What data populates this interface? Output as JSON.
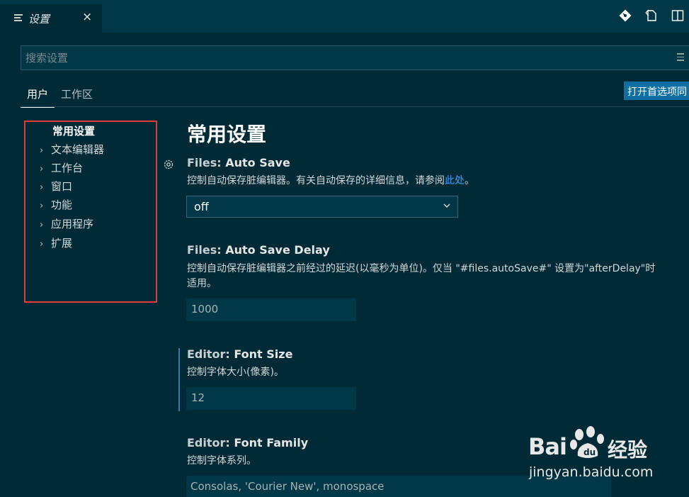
{
  "tab": {
    "label": "设置",
    "close": "×"
  },
  "top_icons": [
    "open-changes-icon",
    "open-file-icon",
    "split-editor-icon"
  ],
  "search": {
    "placeholder": "搜索设置",
    "value": ""
  },
  "scope_tabs": [
    {
      "label": "用户",
      "active": true
    },
    {
      "label": "工作区",
      "active": false
    }
  ],
  "open_json_label": "打开首选项同",
  "toc": {
    "header": "常用设置",
    "items": [
      "文本编辑器",
      "工作台",
      "窗口",
      "功能",
      "应用程序",
      "扩展"
    ]
  },
  "main": {
    "title": "常用设置",
    "settings": [
      {
        "category": "Files: ",
        "name": "Auto Save",
        "desc_before": "控制自动保存脏编辑器。有关自动保存的详细信息，请参阅",
        "desc_link": "此处",
        "desc_after": "。",
        "value": "off"
      },
      {
        "category": "Files: ",
        "name": "Auto Save Delay",
        "desc_line1": "控制自动保存脏编辑器之前经过的延迟(以毫秒为单位)。仅当 \"#files.autoSave#\" 设置为\"afterDelay\"时",
        "desc_line2": "适用。",
        "value": "1000"
      },
      {
        "category": "Editor: ",
        "name": "Font Size",
        "desc": "控制字体大小(像素)。",
        "value": "12"
      },
      {
        "category": "Editor: ",
        "name": "Font Family",
        "desc": "控制字体系列。",
        "value": "Consolas, 'Courier New', monospace"
      }
    ]
  },
  "watermark": {
    "brand1": "Bai",
    "brand2": "经验",
    "url": "jingyan.baidu.com"
  }
}
